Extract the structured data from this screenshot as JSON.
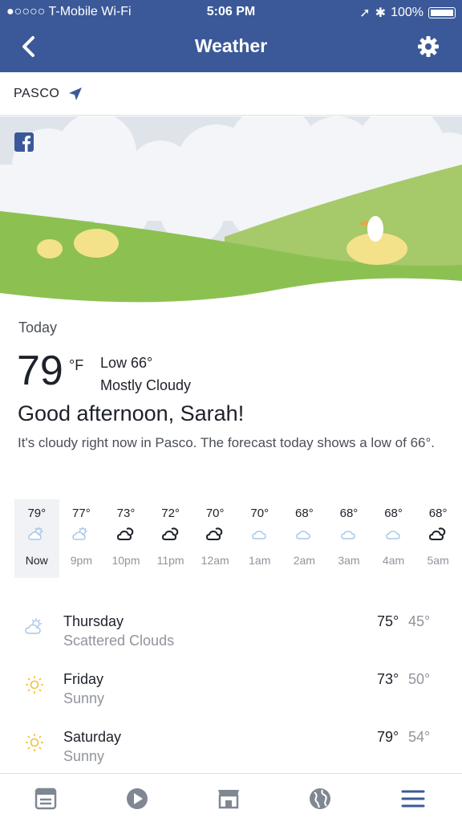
{
  "status_bar": {
    "carrier": "●○○○○ T-Mobile Wi-Fi",
    "time": "5:06 PM",
    "battery": "100%"
  },
  "nav": {
    "title": "Weather",
    "back_icon": "chevron-left-icon",
    "settings_icon": "gear-icon"
  },
  "location": {
    "label": "PASCO",
    "icon": "location-arrow-icon"
  },
  "today": {
    "label": "Today",
    "temp": "79",
    "unit": "°F",
    "low": "Low 66°",
    "condition": "Mostly Cloudy",
    "greeting": "Good afternoon, Sarah!",
    "description": "It's cloudy right now in Pasco. The forecast today shows a low of 66°."
  },
  "hourly": [
    {
      "temp": "79°",
      "time": "Now",
      "icon": "partly-cloudy"
    },
    {
      "temp": "77°",
      "time": "9pm",
      "icon": "partly-cloudy"
    },
    {
      "temp": "73°",
      "time": "10pm",
      "icon": "night-cloud"
    },
    {
      "temp": "72°",
      "time": "11pm",
      "icon": "night-cloud"
    },
    {
      "temp": "70°",
      "time": "12am",
      "icon": "night-cloud"
    },
    {
      "temp": "70°",
      "time": "1am",
      "icon": "cloud"
    },
    {
      "temp": "68°",
      "time": "2am",
      "icon": "cloud"
    },
    {
      "temp": "68°",
      "time": "3am",
      "icon": "cloud"
    },
    {
      "temp": "68°",
      "time": "4am",
      "icon": "cloud"
    },
    {
      "temp": "68°",
      "time": "5am",
      "icon": "night-cloud"
    }
  ],
  "daily": [
    {
      "day": "Thursday",
      "condition": "Scattered Clouds",
      "high": "75°",
      "low": "45°",
      "icon": "partly-cloudy"
    },
    {
      "day": "Friday",
      "condition": "Sunny",
      "high": "73°",
      "low": "50°",
      "icon": "sun"
    },
    {
      "day": "Saturday",
      "condition": "Sunny",
      "high": "79°",
      "low": "54°",
      "icon": "sun"
    }
  ],
  "tabs": [
    "news-feed-icon",
    "video-icon",
    "marketplace-icon",
    "globe-icon",
    "menu-icon"
  ],
  "colors": {
    "brand": "#3b5998",
    "grass": "#8cc152",
    "sky": "#dfe3ea"
  }
}
